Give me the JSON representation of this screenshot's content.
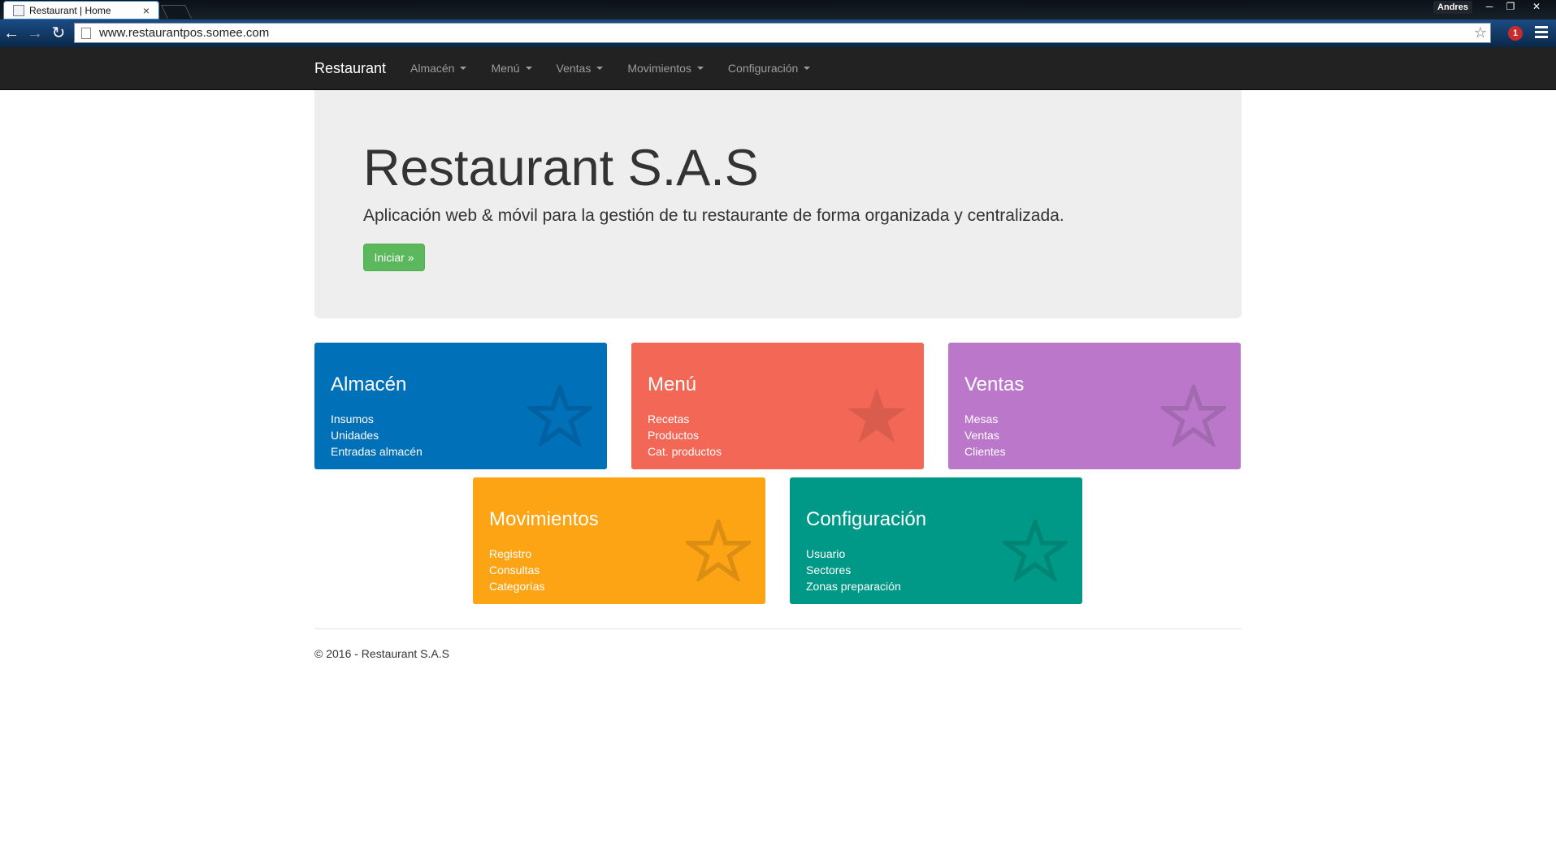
{
  "browser": {
    "tab_title": "Restaurant | Home",
    "tab_close": "×",
    "profile": "Andres",
    "window": {
      "minimize": "─",
      "restore": "❐",
      "close": "✕"
    },
    "url": "www.restaurantpos.somee.com",
    "extension_badge": "1"
  },
  "navbar": {
    "brand": "Restaurant",
    "items": [
      "Almacén",
      "Menú",
      "Ventas",
      "Movimientos",
      "Configuración"
    ]
  },
  "jumbotron": {
    "title": "Restaurant S.A.S",
    "lead": "Aplicación web & móvil para la gestión de tu restaurante de forma organizada y centralizada.",
    "button": "Iniciar »"
  },
  "tiles": [
    {
      "title": "Almacén",
      "links": [
        "Insumos",
        "Unidades",
        "Entradas almacén"
      ],
      "color": "#0070b8",
      "star_style": "outline"
    },
    {
      "title": "Menú",
      "links": [
        "Recetas",
        "Productos",
        "Cat. productos"
      ],
      "color": "#f26755",
      "star_style": "filled"
    },
    {
      "title": "Ventas",
      "links": [
        "Mesas",
        "Ventas",
        "Clientes"
      ],
      "color": "#bb78cb",
      "star_style": "outline"
    },
    {
      "title": "Movimientos",
      "links": [
        "Registro",
        "Consultas",
        "Categorías"
      ],
      "color": "#fda415",
      "star_style": "outline"
    },
    {
      "title": "Configuración",
      "links": [
        "Usuario",
        "Sectores",
        "Zonas preparación"
      ],
      "color": "#009987",
      "star_style": "outline"
    }
  ],
  "footer": {
    "text": "© 2016 - Restaurant S.A.S"
  }
}
